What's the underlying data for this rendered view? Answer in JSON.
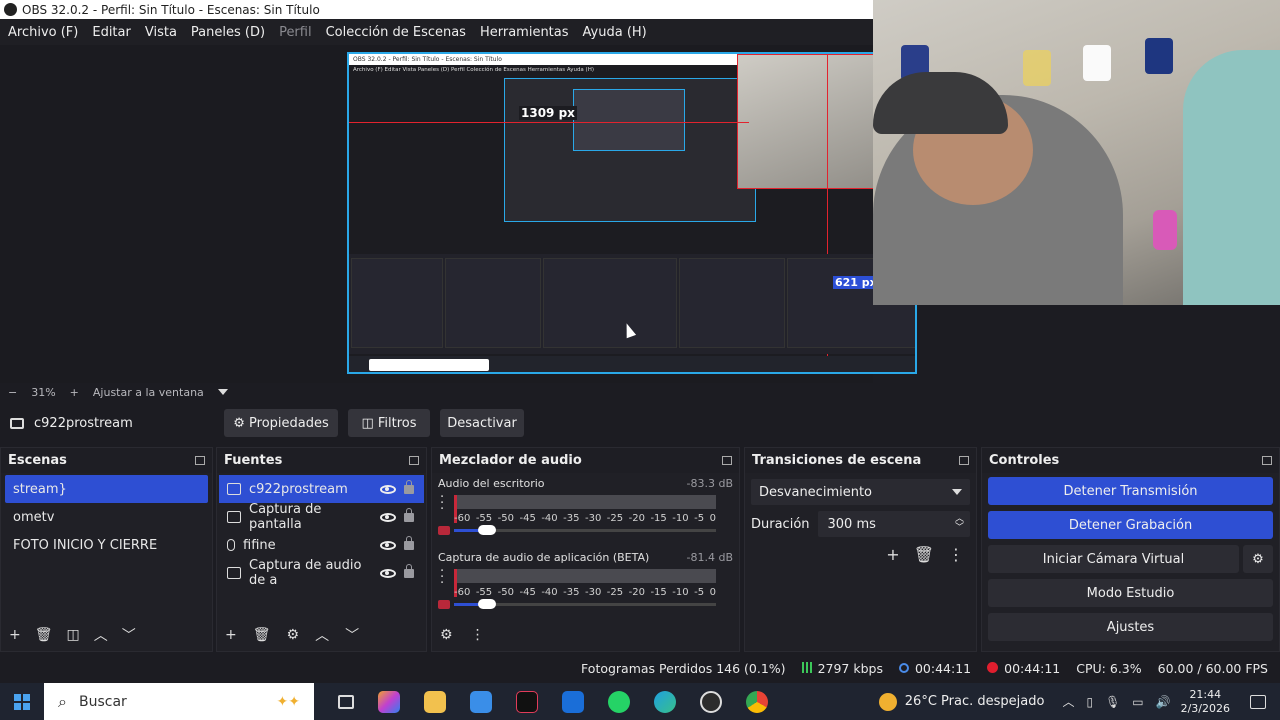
{
  "window": {
    "title": "OBS 32.0.2 - Perfil: Sin Título - Escenas: Sin Título"
  },
  "menu": [
    "Archivo (F)",
    "Editar",
    "Vista",
    "Paneles (D)",
    "Perfil",
    "Colección de Escenas",
    "Herramientas",
    "Ayuda (H)"
  ],
  "preview": {
    "inner_title": "OBS 32.0.2 - Perfil: Sin Título - Escenas: Sin Título",
    "inner_menu": "Archivo (F)   Editar   Vista   Paneles (D)   Perfil   Colección de Escenas   Herramientas   Ayuda (H)",
    "width_label": "1309 px",
    "height_label": "621 px"
  },
  "zoom": {
    "minus": "−",
    "value": "31%",
    "plus": "+",
    "fit": "Ajustar a la ventana"
  },
  "sourcebar": {
    "name": "c922prostream",
    "properties": "Propiedades",
    "filters": "Filtros",
    "deactivate": "Desactivar"
  },
  "scenes": {
    "title": "Escenas",
    "items": [
      "stream}",
      "ometv",
      "FOTO INICIO Y CIERRE"
    ]
  },
  "sources": {
    "title": "Fuentes",
    "items": [
      "c922prostream",
      "Captura de pantalla",
      "fifine",
      "Captura de audio de a"
    ]
  },
  "mixer": {
    "title": "Mezclador de audio",
    "channels": [
      {
        "name": "Audio del escritorio",
        "db": "-83.3 dB"
      },
      {
        "name": "Captura de audio de aplicación (BETA)",
        "db": "-81.4 dB"
      }
    ],
    "scale": [
      "-60",
      "-55",
      "-50",
      "-45",
      "-40",
      "-35",
      "-30",
      "-25",
      "-20",
      "-15",
      "-10",
      "-5",
      "0"
    ]
  },
  "transitions": {
    "title": "Transiciones de escena",
    "selected": "Desvanecimiento",
    "duration_label": "Duración",
    "duration_value": "300 ms"
  },
  "controls": {
    "title": "Controles",
    "stop_stream": "Detener Transmisión",
    "stop_record": "Detener Grabación",
    "virtual_cam": "Iniciar Cámara Virtual",
    "studio_mode": "Modo Estudio",
    "settings": "Ajustes"
  },
  "status": {
    "dropped": "Fotogramas Perdidos 146 (0.1%)",
    "bitrate": "2797 kbps",
    "live_time": "00:44:11",
    "rec_time": "00:44:11",
    "cpu": "CPU: 6.3%",
    "fps": "60.00 / 60.00 FPS"
  },
  "taskbar": {
    "search_placeholder": "Buscar",
    "weather": "26°C  Prac. despejado",
    "time": "21:44",
    "date": "2/3/2026"
  },
  "colors": {
    "accent": "#2e4fd3",
    "preview_border": "#2aa8e8",
    "guide_red": "#e2232e",
    "rec_red": "#e01e2e"
  }
}
